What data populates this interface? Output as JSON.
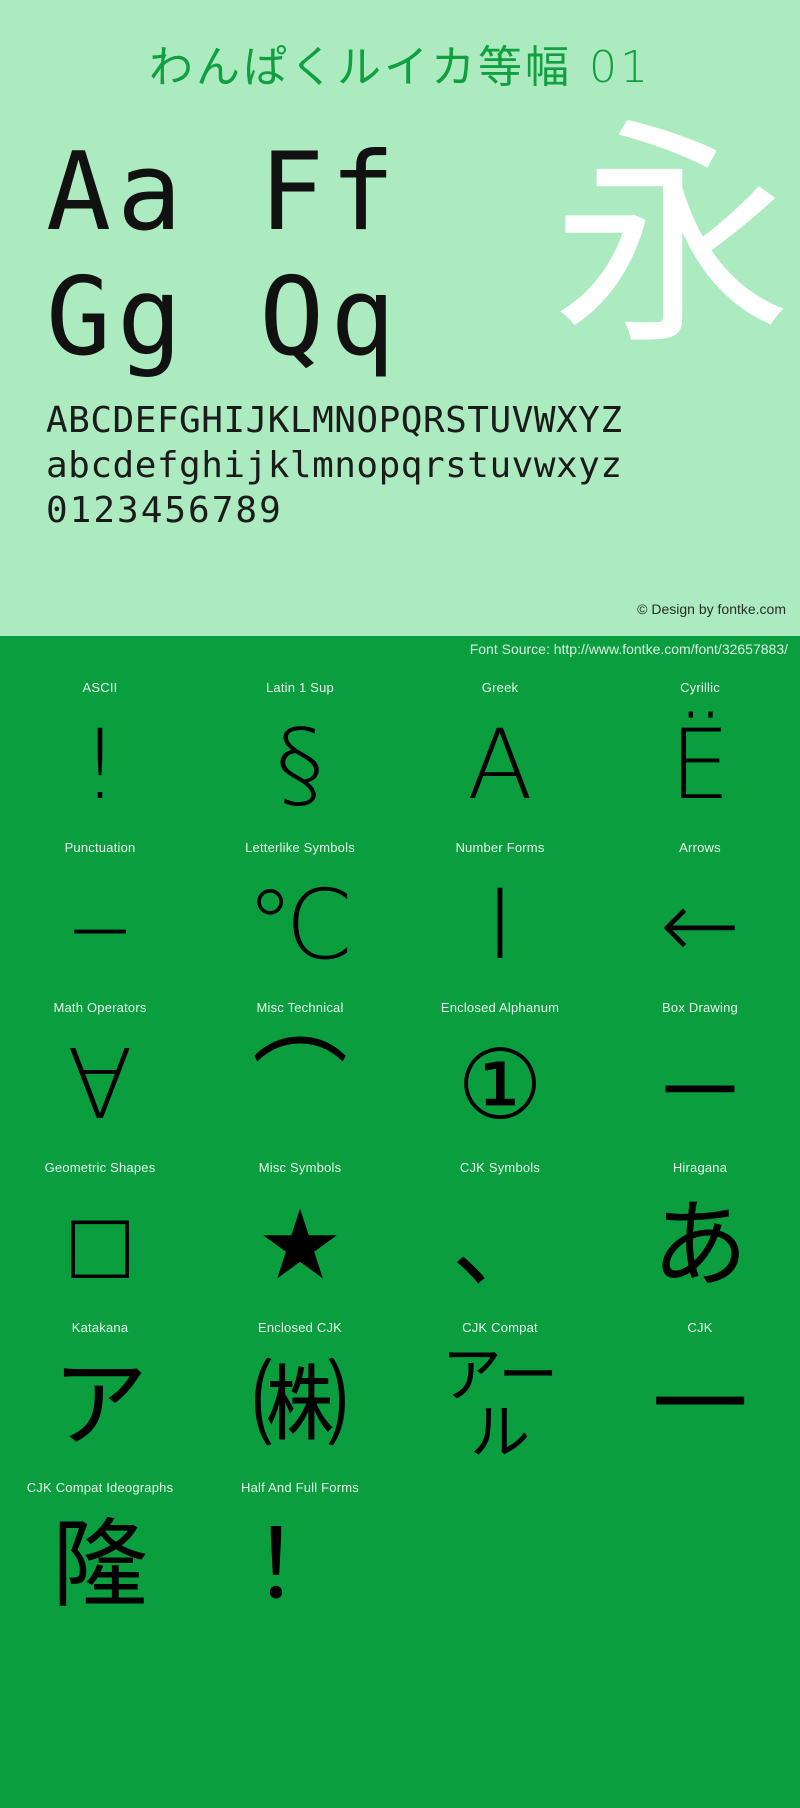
{
  "specimen": {
    "font_title": "わんぱくルイカ等幅 01",
    "title_color": "#10a03f",
    "panel_bg": "#abebbf",
    "page_bg": "#0a9e3f",
    "big_rows": [
      "Aa Ff",
      "Gg Qq"
    ],
    "cjk_sample": "永",
    "alphabet_upper": "ABCDEFGHIJKLMNOPQRSTUVWXYZ",
    "alphabet_lower": "abcdefghijklmnopqrstuvwxyz",
    "digits": "0123456789",
    "copyright": "© Design by fontke.com"
  },
  "source": {
    "text": "Font Source: http://www.fontke.com/font/32657883/"
  },
  "glyph_grid": {
    "rows": [
      [
        {
          "label": "ASCII",
          "glyph": "!"
        },
        {
          "label": "Latin 1 Sup",
          "glyph": "§"
        },
        {
          "label": "Greek",
          "glyph": "Α"
        },
        {
          "label": "Cyrillic",
          "glyph": "Ё"
        }
      ],
      [
        {
          "label": "Punctuation",
          "glyph": "‒"
        },
        {
          "label": "Letterlike Symbols",
          "glyph": "℃"
        },
        {
          "label": "Number Forms",
          "glyph": "Ⅰ"
        },
        {
          "label": "Arrows",
          "glyph": "←"
        }
      ],
      [
        {
          "label": "Math Operators",
          "glyph": "∀"
        },
        {
          "label": "Misc Technical",
          "glyph": "⌒"
        },
        {
          "label": "Enclosed Alphanum",
          "glyph": "①"
        },
        {
          "label": "Box Drawing",
          "glyph": "─"
        }
      ],
      [
        {
          "label": "Geometric Shapes",
          "glyph": "□"
        },
        {
          "label": "Misc Symbols",
          "glyph": "★"
        },
        {
          "label": "CJK Symbols",
          "glyph": "、"
        },
        {
          "label": "Hiragana",
          "glyph": "あ"
        }
      ],
      [
        {
          "label": "Katakana",
          "glyph": "ア"
        },
        {
          "label": "Enclosed CJK",
          "glyph": "㈱"
        },
        {
          "label": "CJK Compat",
          "glyph": "アール"
        },
        {
          "label": "CJK",
          "glyph": "一"
        }
      ],
      [
        {
          "label": "CJK Compat Ideographs",
          "glyph": "隆"
        },
        {
          "label": "Half And Full Forms",
          "glyph": "！"
        },
        {
          "label": "",
          "glyph": ""
        },
        {
          "label": "",
          "glyph": ""
        }
      ]
    ]
  }
}
